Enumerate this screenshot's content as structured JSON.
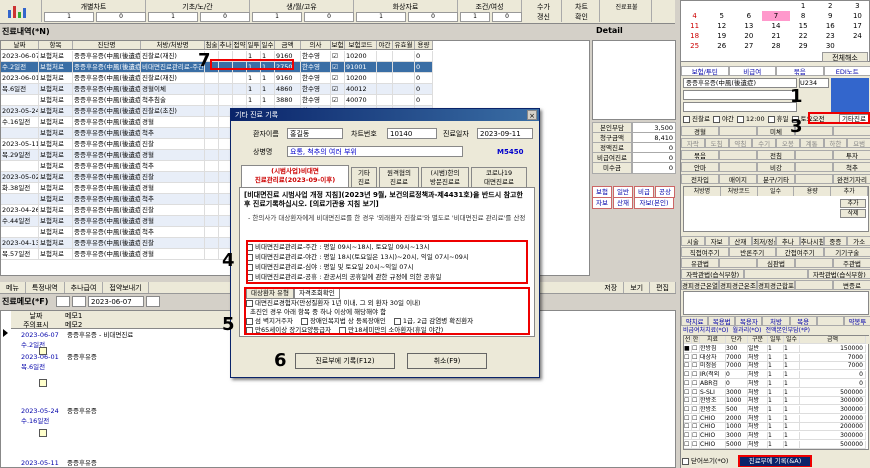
{
  "toolbar": {
    "tabs": [
      "개별차트",
      "기초/노/간",
      "생/월/고유",
      "화상자료",
      "조건/여성"
    ],
    "row2": [
      "1",
      "0",
      "1",
      "0",
      "1",
      "0",
      "1",
      "0",
      "1",
      "0"
    ],
    "btn1": "수가\n갱신",
    "btn2": "차트\n확인",
    "btn3": "진료표불"
  },
  "left_title": "진료내역(*N)",
  "detail_title": "Detail",
  "grid": {
    "headers": [
      "날짜",
      "항목",
      "진단명",
      "처방/처방명",
      "침술",
      "추나",
      "접약",
      "일투",
      "일수",
      "금액",
      "의사",
      "보험",
      "보험코드",
      "야간",
      "유효월",
      "용량"
    ],
    "rows": [
      [
        "2023-06-07",
        "보험처료",
        "중증후유증(中風(後遺症)",
        "진찰료(재진)",
        "",
        "",
        "",
        "1",
        "1",
        "9160",
        "한수영",
        "☑",
        "10200",
        "",
        "",
        "0"
      ],
      [
        "수.2일전",
        "보험처료",
        "중증후유증(中風(後遺症)",
        "비대면진료관리료-주간",
        "",
        "",
        "",
        "1",
        "1",
        "2750",
        "한수영",
        "☑",
        "91001",
        "",
        "",
        "0"
      ],
      [
        "2023-06-01",
        "보험처료",
        "중증후유증(中風(後遺症)",
        "진찰료(재진)",
        "",
        "",
        "",
        "1",
        "1",
        "9160",
        "한수영",
        "☑",
        "10200",
        "",
        "",
        "0"
      ],
      [
        "목.6일전",
        "보험처료",
        "중증후유증(中風(後遺症)",
        "경혈이체",
        "",
        "",
        "",
        "1",
        "1",
        "4860",
        "한수영",
        "☑",
        "40012",
        "",
        "",
        "0"
      ],
      [
        "",
        "보험처료",
        "중증후유증(中風(後遺症)",
        "척추침술",
        "",
        "",
        "",
        "1",
        "1",
        "3880",
        "한수영",
        "☑",
        "40070",
        "",
        "",
        "0"
      ],
      [
        "2023-05-24",
        "보험처료",
        "중증후유증(中風(後遺症)",
        "진찰료(초진)",
        "",
        "",
        "",
        "1",
        "1",
        "14510",
        "한수영",
        "☑",
        "10100",
        "",
        "",
        "0"
      ],
      [
        "수.16일전",
        "보험처료",
        "중증후유증(中風(後遺症)",
        "경혈",
        "",
        "",
        "",
        "",
        "",
        "",
        "",
        "",
        "",
        "",
        "",
        ""
      ],
      [
        "",
        "보험처료",
        "중증후유증(中風(後遺症)",
        "척추",
        "",
        "",
        "",
        "",
        "",
        "",
        "",
        "",
        "",
        "",
        "",
        ""
      ],
      [
        "2023-05-11",
        "보험처료",
        "중증후유증(中風(後遺症)",
        "진찰",
        "",
        "",
        "",
        "",
        "",
        "",
        "",
        "",
        "",
        "",
        "",
        ""
      ],
      [
        "목.29일전",
        "보험처료",
        "중증후유증(中風(後遺症)",
        "경혈",
        "",
        "",
        "",
        "",
        "",
        "",
        "",
        "",
        "",
        "",
        "",
        ""
      ],
      [
        "",
        "보험처료",
        "중증후유증(中風(後遺症)",
        "척추",
        "",
        "",
        "",
        "",
        "",
        "",
        "",
        "",
        "",
        "",
        "",
        ""
      ],
      [
        "2023-05-02",
        "보험처료",
        "중증후유증(中風(後遺症)",
        "진찰",
        "",
        "",
        "",
        "",
        "",
        "",
        "",
        "",
        "",
        "",
        "",
        ""
      ],
      [
        "화.38일전",
        "보험처료",
        "중증후유증(中風(後遺症)",
        "경혈",
        "",
        "",
        "",
        "",
        "",
        "",
        "",
        "",
        "",
        "",
        "",
        ""
      ],
      [
        "",
        "보험처료",
        "중증후유증(中風(後遺症)",
        "척추",
        "",
        "",
        "",
        "",
        "",
        "",
        "",
        "",
        "",
        "",
        "",
        ""
      ],
      [
        "2023-04-26",
        "보험처료",
        "중증후유증(中風(後遺症)",
        "진찰",
        "",
        "",
        "",
        "",
        "",
        "",
        "",
        "",
        "",
        "",
        "",
        ""
      ],
      [
        "수.44일전",
        "보험처료",
        "중증후유증(中風(後遺症)",
        "경혈",
        "",
        "",
        "",
        "",
        "",
        "",
        "",
        "",
        "",
        "",
        "",
        ""
      ],
      [
        "",
        "보험처료",
        "중증후유증(中風(後遺症)",
        "척추",
        "",
        "",
        "",
        "",
        "",
        "",
        "",
        "",
        "",
        "",
        "",
        ""
      ],
      [
        "2023-04-13",
        "보험처료",
        "중증후유증(中風(後遺症)",
        "진찰",
        "",
        "",
        "",
        "",
        "",
        "",
        "",
        "",
        "",
        "",
        "",
        ""
      ],
      [
        "목.57일전",
        "보험처료",
        "중증후유증(中風(後遺症)",
        "경혈",
        "",
        "",
        "",
        "",
        "",
        "",
        "",
        "",
        "",
        "",
        "",
        ""
      ]
    ]
  },
  "rpanel": {
    "labels": [
      "본인부담",
      "청구금액",
      "정액진료",
      "비급여진료",
      "미수금"
    ],
    "values": [
      "3,500",
      "8,410",
      "0",
      "0",
      "0"
    ],
    "buttons": [
      "보험",
      "일반",
      "비급",
      "공상",
      "자보",
      "산재",
      "자보(본인)"
    ]
  },
  "menubar": [
    "메뉴",
    "특정내역",
    "추나급여",
    "접약보내기"
  ],
  "memo": {
    "title": "진료메모(*F)",
    "date": "2023-06-07",
    "headers": [
      "날짜",
      "메모1",
      "주의표시",
      "메모2"
    ],
    "rows": [
      [
        "2023-06-07",
        "중증후유증 - 비대면진료"
      ],
      [
        "수.2일전",
        ""
      ],
      [
        "2023-06-01",
        "중증후유증"
      ],
      [
        "목.6일전",
        ""
      ],
      [
        "2023-05-24",
        "중증후유증"
      ],
      [
        "수.16일전",
        ""
      ],
      [
        "2023-05-11",
        "중증후유증"
      ]
    ]
  },
  "memo_buttons": [
    "저장",
    "보기",
    "편집"
  ],
  "calendar": {
    "rows": [
      [
        "",
        "",
        "",
        "",
        "1",
        "2",
        "3"
      ],
      [
        "4",
        "5",
        "6",
        "7",
        "8",
        "9",
        "10"
      ],
      [
        "11",
        "12",
        "13",
        "14",
        "15",
        "16",
        "17"
      ],
      [
        "18",
        "19",
        "20",
        "21",
        "22",
        "23",
        "24"
      ],
      [
        "25",
        "26",
        "27",
        "28",
        "29",
        "30",
        ""
      ]
    ],
    "view": "전체해소"
  },
  "right": {
    "tabs": [
      "보험/투틴",
      "비급여",
      "묶음",
      "EDI노트"
    ],
    "patient_diag": "중증후유증(中風(後遺症)",
    "diag_code": "U234",
    "options": [
      "진찰료",
      "야간",
      "12:00",
      "휴일",
      "토요오전"
    ],
    "btn_other": "기타진료",
    "rows1": [
      "경혈",
      "",
      "미체",
      "",
      ""
    ],
    "rows2": [
      "자락",
      "도침",
      "약침",
      "수기",
      "오봉",
      "계통",
      "하한",
      "요범"
    ],
    "rows3": [
      "묶음",
      "",
      "전침",
      "",
      "투자"
    ],
    "rows4": [
      "안마",
      "",
      "비강",
      "",
      "척추"
    ],
    "rows5": [
      "전차입",
      "매이지",
      "분구/기타",
      "",
      "완전기자리"
    ],
    "mid_headers": [
      "처방명",
      "처방코드",
      "일수",
      "용량",
      "추가"
    ],
    "mid_btns": [
      "추가",
      "삭제"
    ],
    "rows6": [
      "시술",
      "자보",
      "산재",
      "최저/정신",
      "추나",
      "추나시침",
      "중증",
      "가소"
    ],
    "rows7": [
      "직접여주기",
      "반론주기",
      "간접여주기",
      "기기구술"
    ],
    "rows8": [
      "유관법",
      "",
      "심판법",
      "",
      "주관법"
    ],
    "rows9": [
      "자락관법(습식부항)",
      "",
      "자락관법(습식부항)"
    ],
    "rows10": [
      "경피경근온열",
      "경피경근온조사",
      "경피경근합포",
      "",
      "변증료"
    ],
    "rows11": [
      "약치료",
      "복용법",
      "복용자",
      "처방",
      "복용",
      "",
      "약봉투"
    ],
    "grid_tabs": [
      "비급여처치료(*O)",
      "월과리(*O)",
      "전액본인부담(*P)"
    ],
    "grid_headers": [
      "선",
      "한",
      "치료",
      "단가",
      "구분",
      "일투",
      "일수",
      "금액"
    ],
    "grid_rows": [
      [
        "■",
        "☐",
        "한방침",
        "300",
        "일반",
        "1",
        "1",
        "150000"
      ],
      [
        "☐",
        "☐",
        "대상자",
        "7000",
        "처방",
        "1",
        "1",
        "7000"
      ],
      [
        "☐",
        "☐",
        "미정음",
        "7000",
        "처방",
        "1",
        "1",
        "7000"
      ],
      [
        "☐",
        "☐",
        "IR(적외",
        "0",
        "처방",
        "1",
        "1",
        "0"
      ],
      [
        "☐",
        "☐",
        "ABR검",
        "0",
        "처방",
        "1",
        "1",
        "0"
      ],
      [
        "☐",
        "☐",
        "S-SLI",
        "3000",
        "처방",
        "1",
        "1",
        "500000"
      ],
      [
        "☐",
        "☐",
        "한방조",
        "1000",
        "처방",
        "1",
        "1",
        "300000"
      ],
      [
        "☐",
        "☐",
        "한방조",
        "500",
        "처방",
        "1",
        "1",
        "300000"
      ],
      [
        "☐",
        "☐",
        "CHIO",
        "2000",
        "처방",
        "1",
        "1",
        "200000"
      ],
      [
        "☐",
        "☐",
        "CHIO",
        "1000",
        "처방",
        "1",
        "1",
        "200000"
      ],
      [
        "☐",
        "☐",
        "CHIO",
        "3000",
        "처방",
        "1",
        "1",
        "300000"
      ],
      [
        "☐",
        "☐",
        "CHIO",
        "5000",
        "처방",
        "1",
        "1",
        "500000"
      ]
    ],
    "bottom_check": "닫어쓰기(*O)",
    "bottom_btn": "진료부에 기록(&A)"
  },
  "dialog": {
    "title": "기타 진료 기록",
    "patient_label": "환자이름",
    "patient_name": "홍길동",
    "chart_label": "차트번호",
    "chart_no": "10140",
    "date_label": "진료일자",
    "date": "2023-09-11",
    "disease_label": "상병명",
    "disease": "요통, 척추의 여러 부위",
    "disease_code": "M5450",
    "tabs": [
      "(시범사업)비대면\n진료관리료(2023-09-이후)",
      "기타\n진료",
      "원격협의\n진료료",
      "(시범)한의\n방문진료료",
      "코로나19\n대면진료료"
    ],
    "notice": "[비대면진료 시범사업 개정 지침](2023년 9월, 보건의료정책과-제4431호)을 반드시 참고한 후 진료기록하십시오. [의료기관용 지침 보기]",
    "notice2": "- 한의사가 대상환자에게 비대면진료를 한 경우 '외래환자 진찰료'와 별도로 '비대면진료 관리료'를 산정",
    "fee_items": [
      "비대면진료관리료-주간 : 평일 09시~18시, 토요일 09시~13시",
      "비대면진료관리료-야간 : 평일 18시(토요일은 13시)~20시, 익일 07시~09시",
      "비대면진료관리료-심야 : 평일 및 토요일 20시~익일 07시",
      "비대면진료관리료-공휴 : 관공서의 공휴일에 관한 규정에 의한 공휴일"
    ],
    "subtabs": [
      "대상환자 유형",
      "자격조회확인"
    ],
    "sub_item": "대면진료경험자(만성질환자 1년 이내, 그 외 환자 30일 이내)",
    "sub_note": "초진인 경우 아래 항목 중 하나 이상에 해당해야 함",
    "sub_opts": [
      "섬 벽지거주자",
      "장애인복지법 상 등록장애인",
      "1급, 2급 감염병 확진환자",
      "만65세이상 장기요양등급자",
      "만18세미만의 소아환자(휴일 야간)"
    ],
    "btn_ok": "진료부에 기록(F12)",
    "btn_cancel": "취소(F9)"
  },
  "markers": [
    "7",
    "1",
    "3",
    "4",
    "5",
    "6",
    "2"
  ]
}
